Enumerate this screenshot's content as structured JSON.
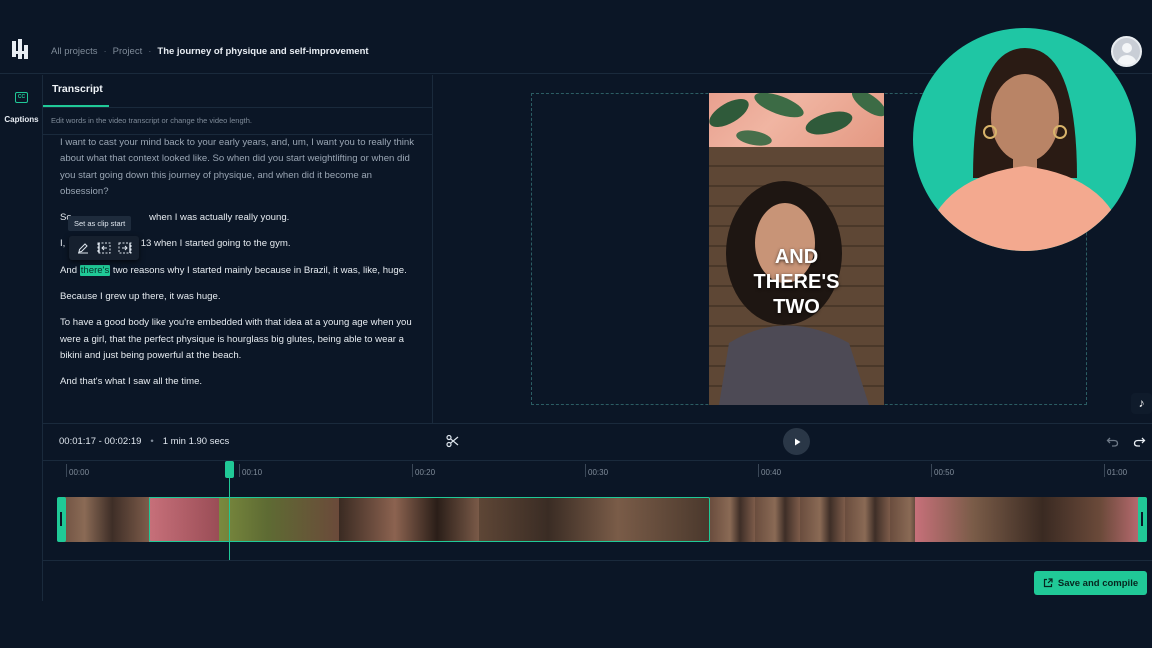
{
  "breadcrumb": {
    "all_projects": "All projects",
    "project": "Project",
    "current": "The journey of physique and self-improvement",
    "separator": "·"
  },
  "rail": {
    "captions_label": "Captions",
    "captions_icon": "CC"
  },
  "transcript": {
    "tab_label": "Transcript",
    "hint": "Edit words in the video transcript or change the video length.",
    "paragraphs": {
      "p1": "I want to cast your mind back to your early years, and, um, I want you to really think about what that context looked like. So when did you start weightlifting or when did you start going down this journey of physique, and when did it become an obsession?",
      "p2_a": "So",
      "p2_b": "when I was actually really young.",
      "p3_a": "I,",
      "p3_b": "13 when I started going to the gym.",
      "p4_a": "And",
      "p4_highlight": "there's",
      "p4_b": "two reasons why I started mainly because in Brazil, it was, like, huge.",
      "p5": "Because I grew up there, it was huge.",
      "p6": "To have a good body like you're embedded with that idea at a young age when you were a girl, that the perfect physique is hourglass big glutes, being able to wear a bikini and just being powerful at the beach.",
      "p7": "And that's what I saw all the time."
    },
    "tooltip": "Set as clip start"
  },
  "clip_info": {
    "range": "00:01:17 - 00:02:19",
    "separator": "•",
    "duration": "1 min 1.90 secs"
  },
  "preview": {
    "caption_lines": [
      "AND",
      "THERE'S",
      "TWO"
    ]
  },
  "timeline": {
    "ticks": [
      "00:00",
      "00:10",
      "00:20",
      "00:30",
      "00:40",
      "00:50",
      "01:00"
    ]
  },
  "actions": {
    "save_label": "Save and compile"
  },
  "colors": {
    "accent": "#20c997",
    "background": "#0b1626",
    "bubble": "#1fc6a4"
  },
  "icons": [
    "logo-icon",
    "captions-icon",
    "edit-icon",
    "clip-start-icon",
    "clip-end-icon",
    "scissors-icon",
    "play-icon",
    "undo-icon",
    "redo-icon",
    "tiktok-icon",
    "external-link-icon",
    "user-avatar-icon"
  ]
}
